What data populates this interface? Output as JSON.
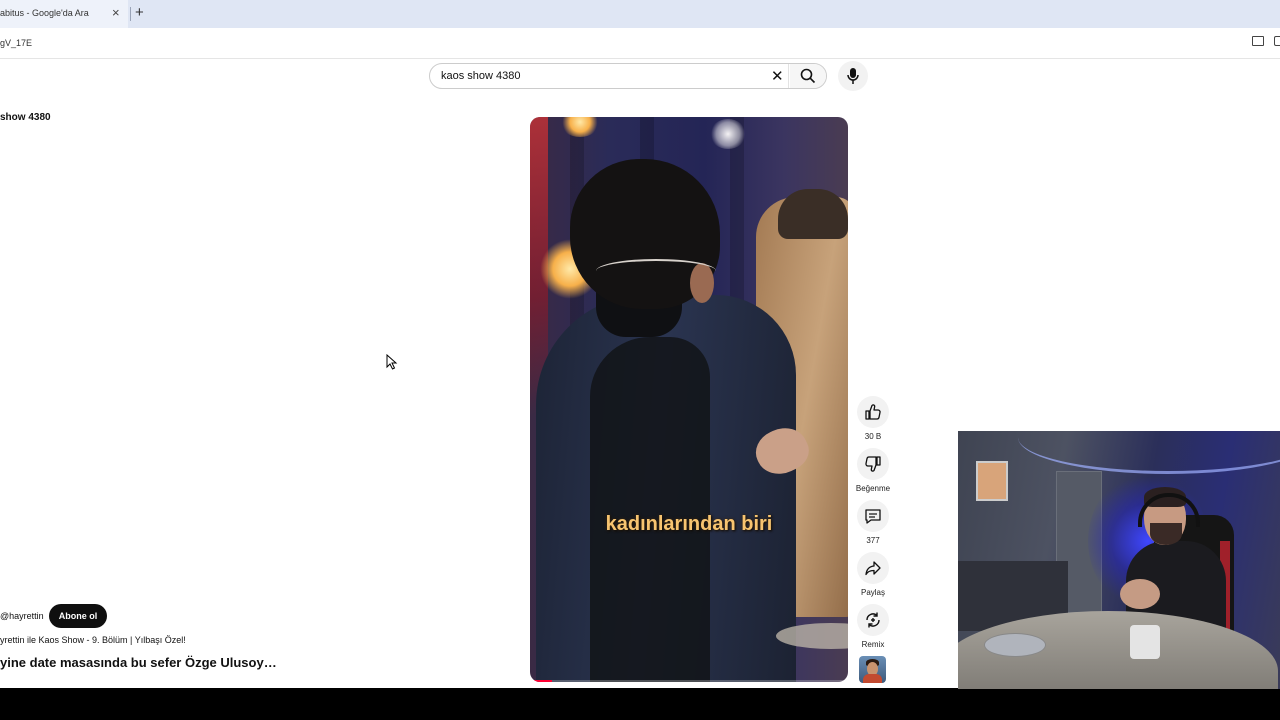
{
  "browser": {
    "tab_title": "abitus - Google'da Ara",
    "tab_close": "×",
    "new_tab": "+",
    "url_fragment": "gV_17E"
  },
  "search": {
    "value": "kaos show 4380",
    "clear": "✕"
  },
  "left_query": "show 4380",
  "video": {
    "caption": "kadınlarından biri",
    "progress_fraction": 0.07
  },
  "actions": {
    "like": "30 B",
    "dislike": "Beğenme",
    "comments": "377",
    "share": "Paylaş",
    "remix": "Remix"
  },
  "channel": {
    "handle": "@hayrettin",
    "subscribe": "Abone ol",
    "linked_title": "yrettin ile Kaos Show - 9. Bölüm | Yılbaşı Özel!",
    "description": "yine date masasında bu sefer Özge Ulusoy…"
  },
  "colors": {
    "accent_red": "#ff0033",
    "caption": "#f7c470",
    "tabstrip": "#dfe6f4"
  }
}
